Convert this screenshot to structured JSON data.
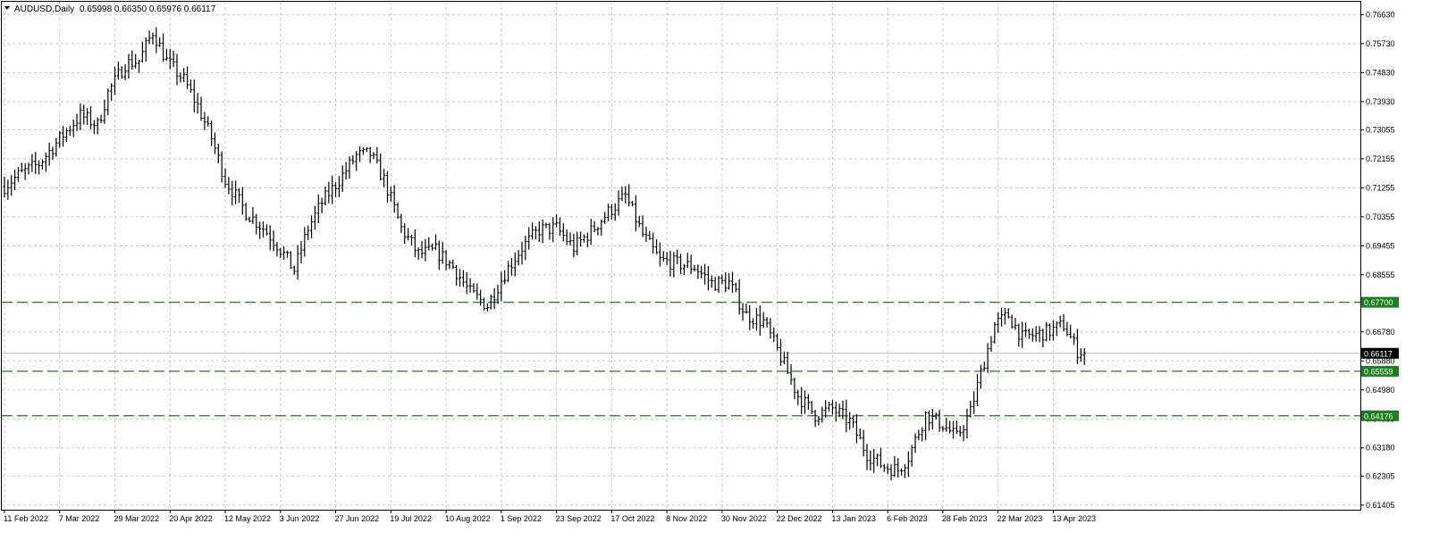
{
  "header": {
    "symbol": "AUDUSD,Daily",
    "ohlc": "0.65998 0.66350 0.65976 0.66117"
  },
  "colors": {
    "background": "#ffffff",
    "grid": "#c8c8c8",
    "bars": "#000000",
    "level_line": "#1e7d1e",
    "level_badge": "#1e7d1e",
    "price_line": "#c0c0c0",
    "price_badge": "#000000"
  },
  "icons": {
    "dropdown": "triangle-down-icon"
  },
  "chart_data": {
    "type": "ohlc",
    "symbol": "AUDUSD",
    "timeframe": "Daily",
    "x_tick_labels": [
      "11 Feb 2022",
      "7 Mar 2022",
      "29 Mar 2022",
      "20 Apr 2022",
      "12 May 2022",
      "3 Jun 2022",
      "27 Jun 2022",
      "19 Jul 2022",
      "10 Aug 2022",
      "1 Sep 2022",
      "23 Sep 2022",
      "17 Oct 2022",
      "8 Nov 2022",
      "30 Nov 2022",
      "22 Dec 2022",
      "13 Jan 2023",
      "6 Feb 2023",
      "28 Feb 2023",
      "22 Mar 2023",
      "13 Apr 2023"
    ],
    "y_tick_labels": [
      "0.76630",
      "0.75730",
      "0.74830",
      "0.73930",
      "0.73055",
      "0.72155",
      "0.71255",
      "0.70355",
      "0.69455",
      "0.68555",
      "0.66780",
      "0.65880",
      "0.64980",
      "0.64080",
      "0.63180",
      "0.62305",
      "0.61405"
    ],
    "ylim": [
      0.6126,
      0.7703
    ],
    "n_bars": 314,
    "bars_per_tick": 16,
    "anchors": [
      [
        0,
        0.713
      ],
      [
        4,
        0.7165
      ],
      [
        10,
        0.72
      ],
      [
        17,
        0.729
      ],
      [
        22,
        0.735
      ],
      [
        27,
        0.732
      ],
      [
        30,
        0.742
      ],
      [
        35,
        0.751
      ],
      [
        39,
        0.752
      ],
      [
        43,
        0.761
      ],
      [
        47,
        0.752
      ],
      [
        52,
        0.746
      ],
      [
        56,
        0.738
      ],
      [
        60,
        0.728
      ],
      [
        64,
        0.715
      ],
      [
        70,
        0.705
      ],
      [
        75,
        0.7
      ],
      [
        79,
        0.695
      ],
      [
        84,
        0.687
      ],
      [
        88,
        0.7
      ],
      [
        92,
        0.708
      ],
      [
        97,
        0.715
      ],
      [
        102,
        0.7225
      ],
      [
        106,
        0.723
      ],
      [
        110,
        0.715
      ],
      [
        115,
        0.7
      ],
      [
        120,
        0.692
      ],
      [
        125,
        0.693
      ],
      [
        130,
        0.688
      ],
      [
        135,
        0.68
      ],
      [
        140,
        0.676
      ],
      [
        145,
        0.686
      ],
      [
        150,
        0.694
      ],
      [
        155,
        0.6995
      ],
      [
        160,
        0.7
      ],
      [
        165,
        0.694
      ],
      [
        170,
        0.699
      ],
      [
        175,
        0.705
      ],
      [
        180,
        0.71
      ],
      [
        185,
        0.698
      ],
      [
        190,
        0.69
      ],
      [
        195,
        0.689
      ],
      [
        200,
        0.688
      ],
      [
        205,
        0.683
      ],
      [
        210,
        0.683
      ],
      [
        215,
        0.673
      ],
      [
        220,
        0.671
      ],
      [
        225,
        0.66
      ],
      [
        230,
        0.648
      ],
      [
        235,
        0.642
      ],
      [
        240,
        0.644
      ],
      [
        245,
        0.64
      ],
      [
        250,
        0.63
      ],
      [
        255,
        0.626
      ],
      [
        259,
        0.625
      ],
      [
        262,
        0.629
      ],
      [
        267,
        0.642
      ],
      [
        272,
        0.639
      ],
      [
        276,
        0.635
      ],
      [
        280,
        0.643
      ],
      [
        283,
        0.655
      ],
      [
        287,
        0.67
      ],
      [
        291,
        0.673
      ],
      [
        295,
        0.666
      ],
      [
        299,
        0.667
      ],
      [
        303,
        0.668
      ],
      [
        307,
        0.67
      ],
      [
        311,
        0.662
      ],
      [
        314,
        0.6612
      ]
    ],
    "levels": [
      {
        "value": 0.677,
        "label": "0.67700"
      },
      {
        "value": 0.65559,
        "label": "0.65559"
      },
      {
        "value": 0.64176,
        "label": "0.64176"
      }
    ],
    "current_price": {
      "value": 0.66117,
      "label": "0.66117"
    },
    "grid": true
  }
}
